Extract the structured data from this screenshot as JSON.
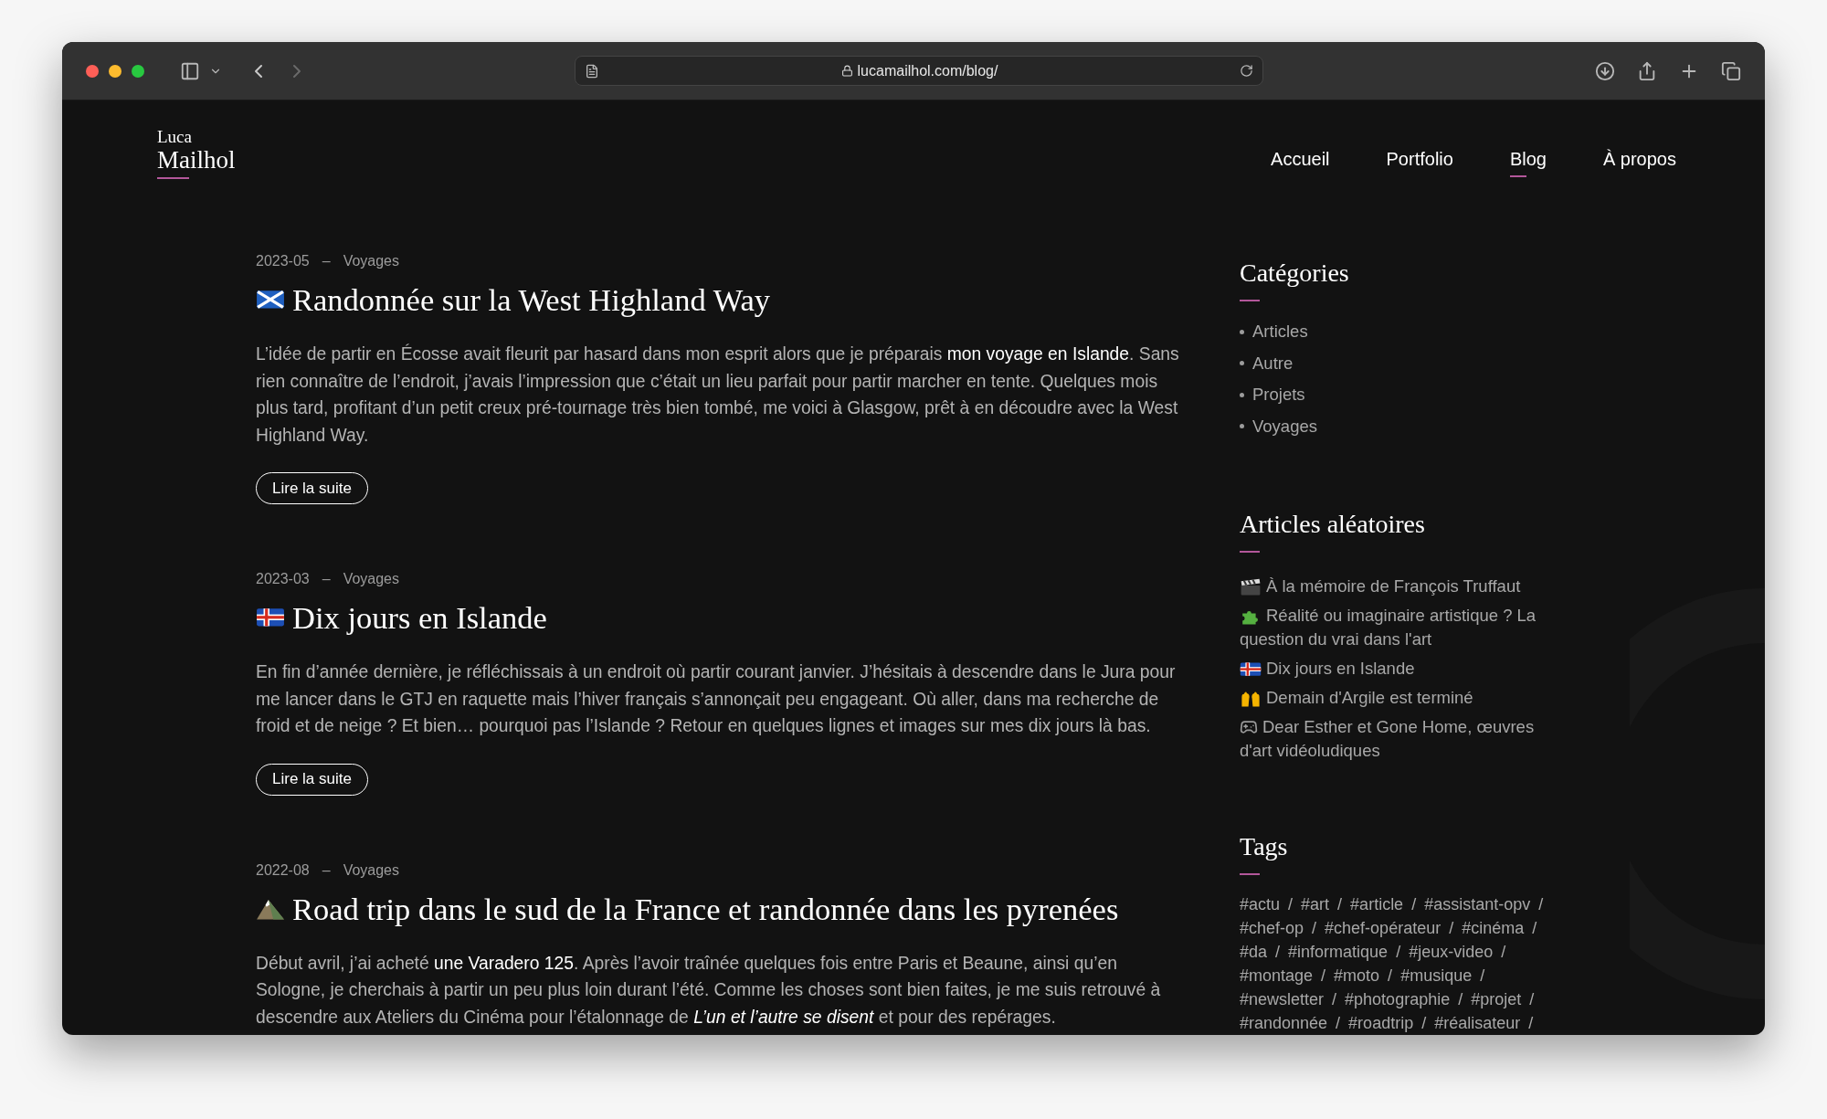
{
  "browser": {
    "url": "lucamailhol.com/blog/"
  },
  "site": {
    "logo": {
      "first": "Luca",
      "last": "Mailhol"
    },
    "nav": [
      {
        "label": "Accueil",
        "selected": false
      },
      {
        "label": "Portfolio",
        "selected": false
      },
      {
        "label": "Blog",
        "selected": true
      },
      {
        "label": "À propos",
        "selected": false
      }
    ]
  },
  "posts": [
    {
      "date": "2023-05",
      "separator": "–",
      "category": "Voyages",
      "kind": "scotland_flag",
      "title": "Randonnée sur la West Highland Way",
      "excerpt": [
        {
          "kind": "plain",
          "text": "L’idée de partir en Écosse avait fleurit par hasard dans mon esprit alors que je préparais "
        },
        {
          "kind": "link",
          "text": "mon voyage en Islande"
        },
        {
          "kind": "plain",
          "text": ". Sans rien connaître de l’endroit, j’avais l’impression que c’était un lieu parfait pour partir marcher en tente. Quelques mois plus tard, profitant d’un petit creux pré-tournage très bien tombé, me voici à Glasgow, prêt à en découdre avec la West Highland Way."
        }
      ],
      "button": "Lire la suite"
    },
    {
      "date": "2023-03",
      "separator": "–",
      "category": "Voyages",
      "kind": "iceland_flag",
      "title": "Dix jours en Islande",
      "excerpt": [
        {
          "kind": "plain",
          "text": "En fin d’année dernière, je réfléchissais à un endroit où partir courant janvier. J’hésitais à descendre dans le Jura pour me lancer dans le GTJ en raquette mais l’hiver français s’annonçait peu engageant. Où aller, dans ma recherche de froid et de neige ? Et bien… pourquoi pas l’Islande ? Retour en quelques lignes et images sur mes dix jours là bas."
        }
      ],
      "button": "Lire la suite"
    },
    {
      "date": "2022-08",
      "separator": "–",
      "category": "Voyages",
      "kind": "mountain",
      "title": "Road trip dans le sud de la France et randonnée dans les pyrenées",
      "excerpt": [
        {
          "kind": "plain",
          "text": "Début avril, j’ai acheté "
        },
        {
          "kind": "link",
          "text": "une Varadero 125"
        },
        {
          "kind": "plain",
          "text": ". Après l’avoir traînée quelques fois entre Paris et Beaune, ainsi qu’en Sologne, je cherchais à partir un peu plus loin durant l’été. Comme les choses sont bien faites, je me suis retrouvé à descendre aux Ateliers du Cinéma pour l’étalonnage de "
        },
        {
          "kind": "italic_link",
          "text": "L’un et l’autre se disent"
        },
        {
          "kind": "plain",
          "text": " et pour des repérages."
        }
      ]
    }
  ],
  "sidebar": {
    "categories": {
      "title": "Catégories",
      "items": [
        "Articles",
        "Autre",
        "Projets",
        "Voyages"
      ]
    },
    "random": {
      "title": "Articles aléatoires",
      "items": [
        {
          "kind": "clapper",
          "text": "À la mémoire de François Truffaut"
        },
        {
          "kind": "puzzle",
          "text": "Réalité ou imaginaire artistique ? La question du vrai dans l'art"
        },
        {
          "kind": "iceland_flag",
          "text": "Dix jours en Islande"
        },
        {
          "kind": "raised_hands",
          "text": "Demain d'Argile est terminé"
        },
        {
          "kind": "gamepad",
          "text": "Dear Esther et Gone Home, œuvres d'art vidéoludiques"
        }
      ]
    },
    "tags": {
      "title": "Tags",
      "rows": [
        {
          "items": [
            {
              "tag": "#actu",
              "sep": "/"
            },
            {
              "tag": "#art",
              "sep": "/"
            },
            {
              "tag": "#article",
              "sep": "/"
            },
            {
              "tag": "#assistant-opv",
              "sep": "/"
            }
          ]
        },
        {
          "items": [
            {
              "tag": "#chef-op",
              "sep": "/"
            },
            {
              "tag": "#chef-opérateur",
              "sep": "/"
            },
            {
              "tag": "#cinéma",
              "sep": "/"
            }
          ]
        },
        {
          "items": [
            {
              "tag": "#da",
              "sep": "/"
            },
            {
              "tag": "#informatique",
              "sep": "/"
            },
            {
              "tag": "#jeux-video",
              "sep": "/"
            }
          ]
        },
        {
          "items": [
            {
              "tag": "#montage",
              "sep": "/"
            },
            {
              "tag": "#moto",
              "sep": "/"
            },
            {
              "tag": "#musique",
              "sep": "/"
            }
          ]
        },
        {
          "items": [
            {
              "tag": "#newsletter",
              "sep": "/"
            },
            {
              "tag": "#photographie",
              "sep": "/"
            },
            {
              "tag": "#projet",
              "sep": "/"
            }
          ]
        },
        {
          "items": [
            {
              "tag": "#randonnée",
              "sep": "/"
            },
            {
              "tag": "#roadtrip",
              "sep": "/"
            },
            {
              "tag": "#réalisateur",
              "sep": "/"
            }
          ]
        }
      ]
    }
  }
}
